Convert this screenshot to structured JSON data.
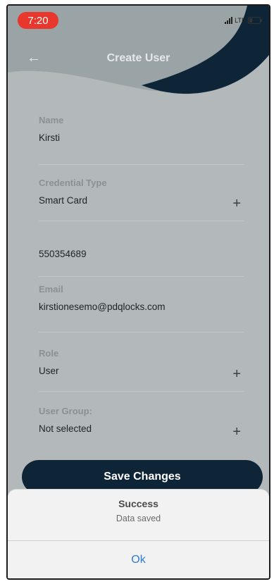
{
  "status": {
    "time": "7:20",
    "network": "LTE"
  },
  "header": {
    "title": "Create User",
    "back_icon": "arrow-left-icon"
  },
  "form": {
    "name": {
      "label": "Name",
      "value": "Kirsti"
    },
    "credential_type": {
      "label": "Credential Type",
      "value": "Smart Card"
    },
    "credential_number": {
      "value": "550354689"
    },
    "email": {
      "label": "Email",
      "value": "kirstionesemo@pdqlocks.com"
    },
    "role": {
      "label": "Role",
      "value": "User"
    },
    "user_group": {
      "label": "User Group:",
      "value": "Not selected"
    },
    "plus_symbol": "+"
  },
  "save_button": {
    "label": "Save Changes"
  },
  "alert": {
    "title": "Success",
    "message": "Data saved",
    "ok_label": "Ok"
  },
  "colors": {
    "background": "#b3b8bb",
    "header_wave_light": "#9aa3a6",
    "header_wave_dark": "#0e2538",
    "status_pill": "#e8372d",
    "save_button": "#0e2538",
    "link_blue": "#2f7bd6"
  }
}
